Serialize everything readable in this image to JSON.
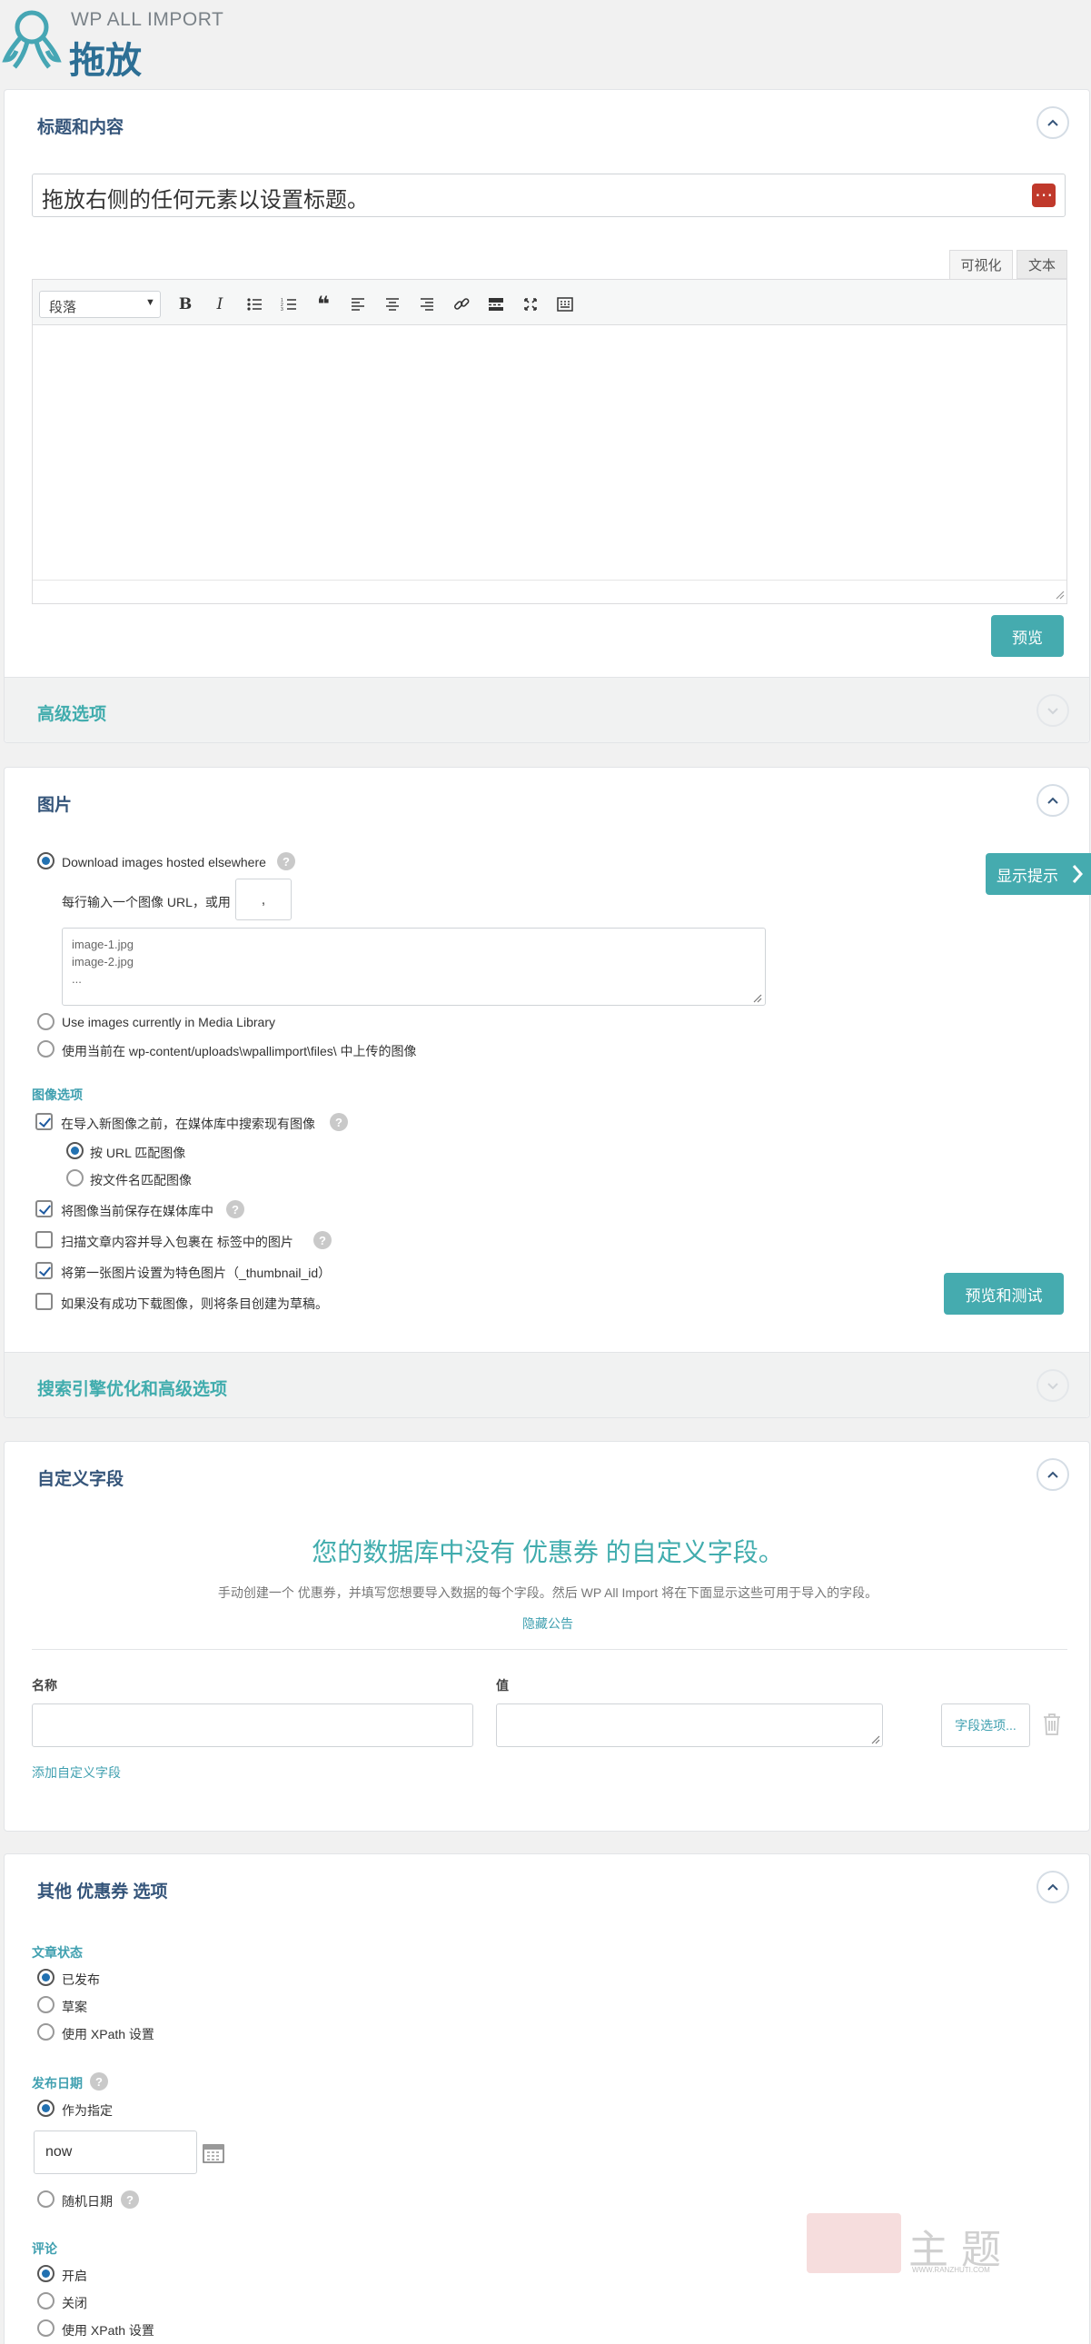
{
  "header": {
    "brand": "WP ALL IMPORT",
    "title": "拖放"
  },
  "title_section": {
    "heading": "标题和内容",
    "title_placeholder": "拖放右侧的任何元素以设置标题。",
    "editor_tabs": [
      "可视化",
      "文本"
    ],
    "format_select": "段落",
    "preview_button": "预览",
    "advanced_heading": "高级选项"
  },
  "images_section": {
    "heading": "图片",
    "show_hints_button": "显示提示",
    "option_download": "Download images hosted elsewhere",
    "url_hint": "每行输入一个图像 URL，或用",
    "separator_value": ",",
    "textarea_lines": "image-1.jpg\nimage-2.jpg\n...",
    "option_media_library": "Use images currently in Media Library",
    "option_uploaded": "使用当前在 wp-content/uploads\\wpallimport\\files\\ 中上传的图像",
    "image_options_label": "图像选项",
    "search_existing": "在导入新图像之前，在媒体库中搜索现有图像",
    "match_url": "按 URL 匹配图像",
    "match_filename": "按文件名匹配图像",
    "keep_in_library": "将图像当前保存在媒体库中",
    "scan_content": "扫描文章内容并导入包裹在  标签中的图片",
    "set_featured": "将第一张图片设置为特色图片（_thumbnail_id）",
    "draft_on_fail": "如果没有成功下载图像，则将条目创建为草稿。",
    "preview_test_button": "预览和测试",
    "seo_heading": "搜索引擎优化和高级选项"
  },
  "custom_fields": {
    "heading": "自定义字段",
    "notice_title": "您的数据库中没有 优惠券 的自定义字段。",
    "notice_desc": "手动创建一个 优惠券，并填写您想要导入数据的每个字段。然后 WP All Import 将在下面显示这些可用于导入的字段。",
    "hide_notice": "隐藏公告",
    "col_name": "名称",
    "col_value": "值",
    "field_options_button": "字段选项...",
    "add_field_link": "添加自定义字段"
  },
  "other_options": {
    "heading": "其他 优惠券 选项",
    "post_status_label": "文章状态",
    "status_published": "已发布",
    "status_draft": "草案",
    "status_xpath": "使用 XPath 设置",
    "post_date_label": "发布日期",
    "date_as_specified": "作为指定",
    "date_value": "now",
    "date_random": "随机日期",
    "comments_label": "评论",
    "comments_open": "开启",
    "comments_closed": "关闭",
    "comments_xpath": "使用 XPath 设置"
  },
  "watermark": {
    "text": "主题",
    "site": "WWW.RANZHUTI.COM"
  },
  "colors": {
    "accent_teal": "#45abaf",
    "heading_blue": "#35557a",
    "title_icon_red": "#c0392b"
  }
}
